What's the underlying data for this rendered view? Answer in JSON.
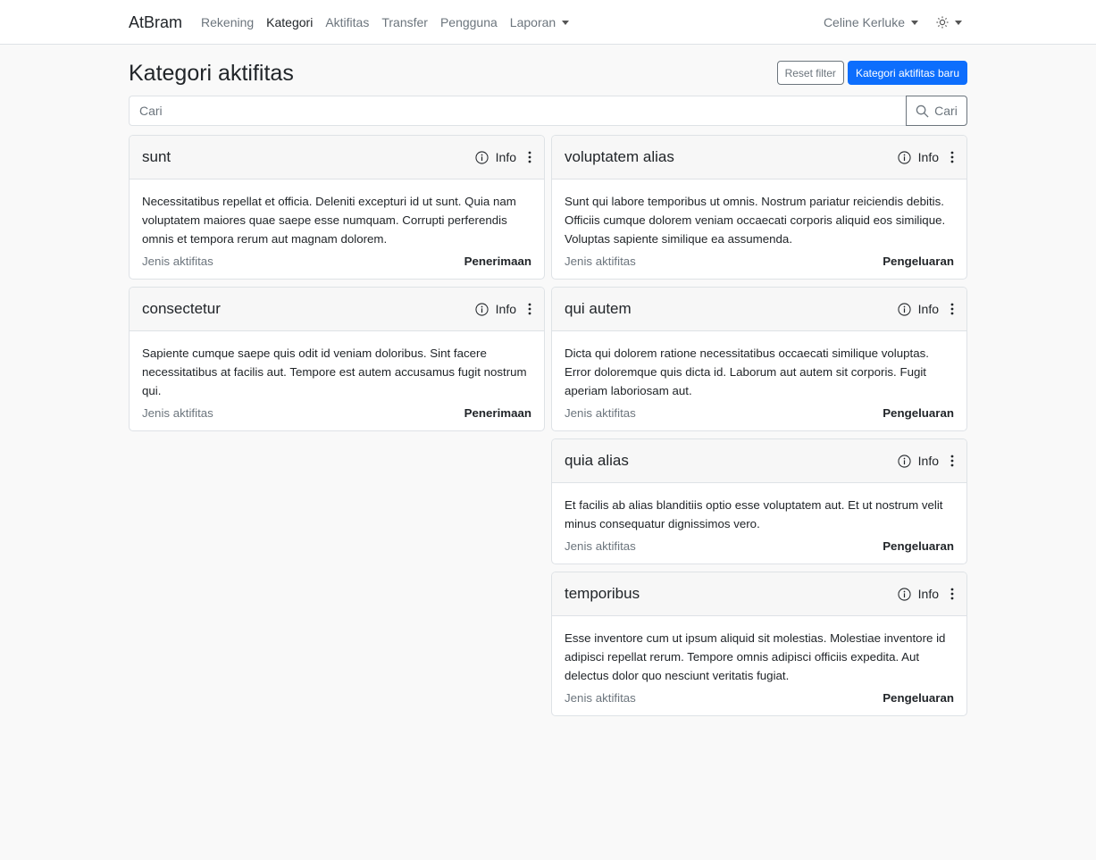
{
  "nav": {
    "brand": "AtBram",
    "links": [
      "Rekening",
      "Kategori",
      "Aktifitas",
      "Transfer",
      "Pengguna"
    ],
    "reports": "Laporan",
    "user": "Celine Kerluke"
  },
  "page": {
    "title": "Kategori aktifitas",
    "reset_label": "Reset filter",
    "new_label": "Kategori aktifitas baru",
    "search_placeholder": "Cari",
    "search_button": "Cari"
  },
  "cards": [
    {
      "title": "sunt",
      "info": "Info",
      "description": "Necessitatibus repellat et officia. Deleniti excepturi id ut sunt. Quia nam voluptatem maiores quae saepe esse numquam. Corrupti perferendis omnis et tempora rerum aut magnam dolorem.",
      "type_label": "Jenis aktifitas",
      "type_value": "Penerimaan"
    },
    {
      "title": "consectetur",
      "info": "Info",
      "description": "Sapiente cumque saepe quis odit id veniam doloribus. Sint facere necessitatibus at facilis aut. Tempore est autem accusamus fugit nostrum qui.",
      "type_label": "Jenis aktifitas",
      "type_value": "Penerimaan"
    },
    {
      "title": "voluptatem alias",
      "info": "Info",
      "description": "Sunt qui labore temporibus ut omnis. Nostrum pariatur reiciendis debitis. Officiis cumque dolorem veniam occaecati corporis aliquid eos similique. Voluptas sapiente similique ea assumenda.",
      "type_label": "Jenis aktifitas",
      "type_value": "Pengeluaran"
    },
    {
      "title": "qui autem",
      "info": "Info",
      "description": "Dicta qui dolorem ratione necessitatibus occaecati similique voluptas. Error doloremque quis dicta id. Laborum aut autem sit corporis. Fugit aperiam laboriosam aut.",
      "type_label": "Jenis aktifitas",
      "type_value": "Pengeluaran"
    },
    {
      "title": "quia alias",
      "info": "Info",
      "description": "Et facilis ab alias blanditiis optio esse voluptatem aut. Et ut nostrum velit minus consequatur dignissimos vero.",
      "type_label": "Jenis aktifitas",
      "type_value": "Pengeluaran"
    },
    {
      "title": "temporibus",
      "info": "Info",
      "description": "Esse inventore cum ut ipsum aliquid sit molestias. Molestiae inventore id adipisci repellat rerum. Tempore omnis adipisci officiis expedita. Aut delectus dolor quo nesciunt veritatis fugiat.",
      "type_label": "Jenis aktifitas",
      "type_value": "Pengeluaran"
    }
  ]
}
